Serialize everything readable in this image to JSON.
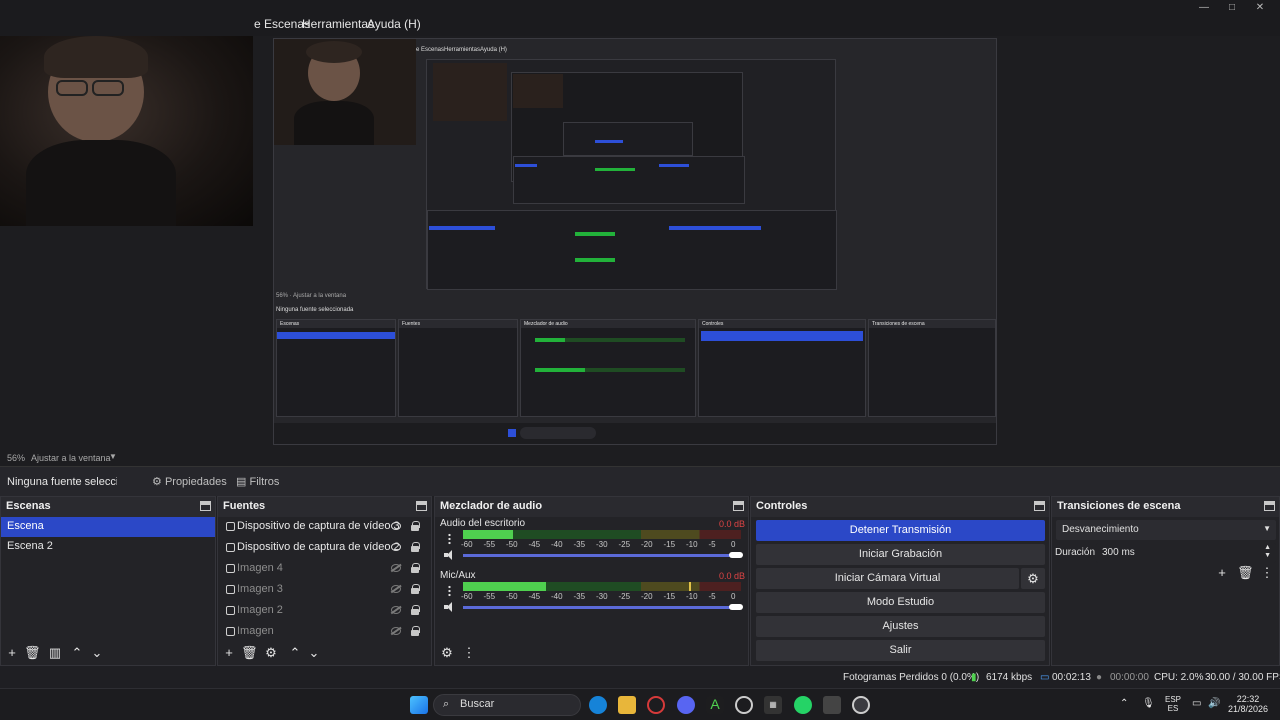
{
  "menu": {
    "items": [
      "e Escenas",
      "Herramientas",
      "Ayuda (H)"
    ]
  },
  "nested_menu": {
    "items": [
      "e Escenas",
      "Herramientas",
      "Ayuda (H)"
    ]
  },
  "zoom": {
    "percent": "56%",
    "mode": "Ajustar a la ventana"
  },
  "source_toolbar": {
    "status": "Ninguna fuente seleccionada",
    "properties": "Propiedades",
    "filters": "Filtros"
  },
  "docks": {
    "scenes": {
      "title": "Escenas",
      "items": [
        {
          "label": "Escena",
          "active": true
        },
        {
          "label": "Escena 2",
          "active": false
        }
      ]
    },
    "sources": {
      "title": "Fuentes",
      "items": [
        {
          "label": "Dispositivo de captura de vídeo 3",
          "visible": true
        },
        {
          "label": "Dispositivo de captura de vídeo 2",
          "visible": true
        },
        {
          "label": "Imagen 4",
          "visible": false
        },
        {
          "label": "Imagen 3",
          "visible": false
        },
        {
          "label": "Imagen 2",
          "visible": false
        },
        {
          "label": "Imagen",
          "visible": false
        }
      ]
    },
    "mixer": {
      "title": "Mezclador de audio",
      "scale": [
        "-60",
        "-55",
        "-50",
        "-45",
        "-40",
        "-35",
        "-30",
        "-25",
        "-20",
        "-15",
        "-10",
        "-5",
        "0"
      ],
      "channels": [
        {
          "name": "Audio del escritorio",
          "db": "0.0 dB",
          "level": 0.18
        },
        {
          "name": "Mic/Aux",
          "db": "0.0 dB",
          "level": 0.3
        }
      ]
    },
    "controls": {
      "title": "Controles",
      "buttons": {
        "stop_stream": "Detener Transmisión",
        "start_record": "Iniciar Grabación",
        "virtual_cam": "Iniciar Cámara Virtual",
        "studio": "Modo Estudio",
        "settings": "Ajustes",
        "exit": "Salir"
      }
    },
    "transitions": {
      "title": "Transiciones de escena",
      "selected": "Desvanecimiento",
      "duration_label": "Duración",
      "duration_value": "300 ms"
    }
  },
  "status": {
    "dropped": "Fotogramas Perdidos 0 (0.0%)",
    "bitrate": "6174 kbps",
    "stream_time": "00:02:13",
    "rec_time": "00:00:00",
    "cpu": "CPU: 2.0%",
    "fps": "30.00 / 30.00 FPS"
  },
  "taskbar": {
    "search": "Buscar",
    "lang_top": "ESP",
    "lang_bottom": "ES",
    "time": "22:32",
    "date": "21/8/2026"
  },
  "colors": {
    "accent": "#2b48c7",
    "meter_green": "#4fd04f",
    "panel": "#232327"
  }
}
